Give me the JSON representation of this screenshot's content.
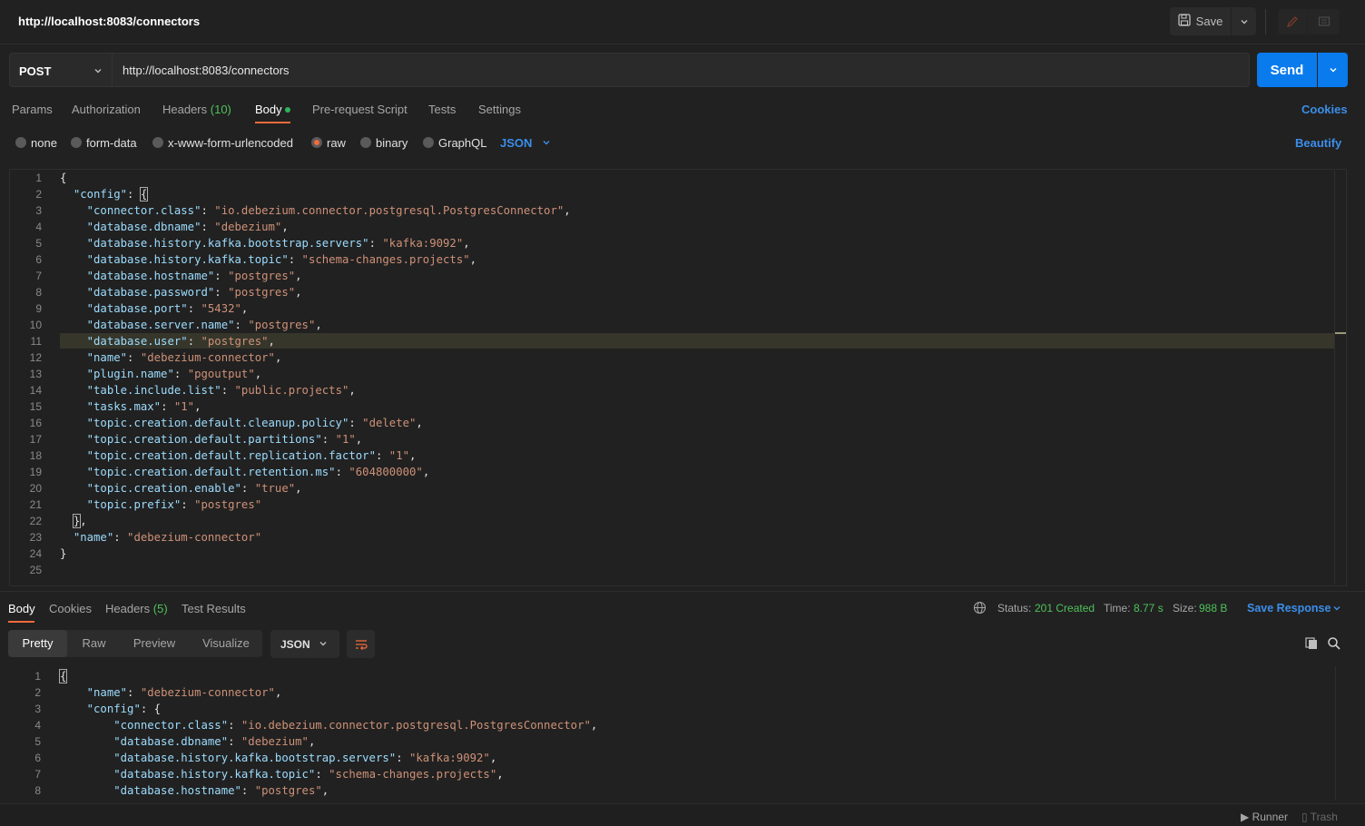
{
  "tab": {
    "title": "http://localhost:8083/connectors"
  },
  "toolbar": {
    "save_label": "Save"
  },
  "request": {
    "method": "POST",
    "url": "http://localhost:8083/connectors",
    "send_label": "Send"
  },
  "request_tabs": [
    {
      "label": "Params"
    },
    {
      "label": "Authorization"
    },
    {
      "label": "Headers",
      "count": "(10)"
    },
    {
      "label": "Body"
    },
    {
      "label": "Pre-request Script"
    },
    {
      "label": "Tests"
    },
    {
      "label": "Settings"
    }
  ],
  "cookies_label": "Cookies",
  "body_types": [
    "none",
    "form-data",
    "x-www-form-urlencoded",
    "raw",
    "binary",
    "GraphQL"
  ],
  "body_type_selected": "raw",
  "raw_format": "JSON",
  "beautify_label": "Beautify",
  "editor": {
    "line_numbers": [
      "1",
      "2",
      "3",
      "4",
      "5",
      "6",
      "7",
      "8",
      "9",
      "10",
      "11",
      "12",
      "13",
      "14",
      "15",
      "16",
      "17",
      "18",
      "19",
      "20",
      "21",
      "22",
      "23",
      "24",
      "25"
    ],
    "highlighted_line": 11
  },
  "response": {
    "tabs": [
      {
        "label": "Body"
      },
      {
        "label": "Cookies"
      },
      {
        "label": "Headers",
        "count": "(5)"
      },
      {
        "label": "Test Results"
      }
    ],
    "status_label": "Status:",
    "status_value": "201 Created",
    "time_label": "Time:",
    "time_value": "8.77 s",
    "size_label": "Size:",
    "size_value": "988 B",
    "save_response_label": "Save Response",
    "views": [
      "Pretty",
      "Raw",
      "Preview",
      "Visualize"
    ],
    "format": "JSON",
    "line_numbers": [
      "1",
      "2",
      "3",
      "4",
      "5",
      "6",
      "7",
      "8"
    ]
  },
  "statusbar": {
    "runner_label": "Runner",
    "trash_label": "Trash"
  },
  "colors": {
    "accent": "#097bed",
    "active_tab": "#f26b3a",
    "success": "#4fc15b",
    "link": "#3b8eea"
  }
}
